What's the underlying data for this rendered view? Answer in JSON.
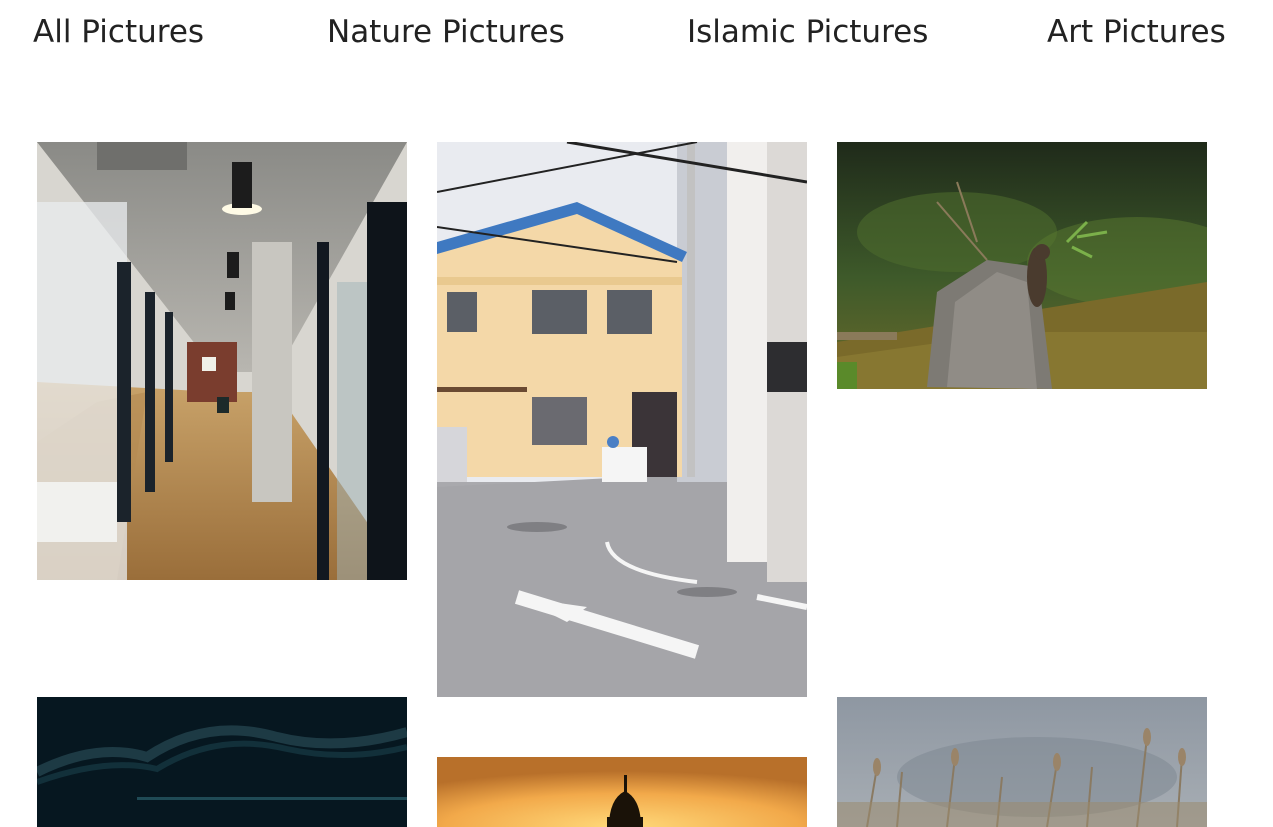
{
  "nav": {
    "all": "All Pictures",
    "nature": "Nature Pictures",
    "islamic": "Islamic Pictures",
    "art": "Art Pictures"
  },
  "gallery": {
    "photos": [
      {
        "subject": "office-corridor"
      },
      {
        "subject": "street-corner-house"
      },
      {
        "subject": "squirrel-on-stump"
      },
      {
        "subject": "dark-mesh-structure"
      },
      {
        "subject": "mosque-dome-sunset"
      },
      {
        "subject": "foggy-reeds"
      }
    ]
  }
}
